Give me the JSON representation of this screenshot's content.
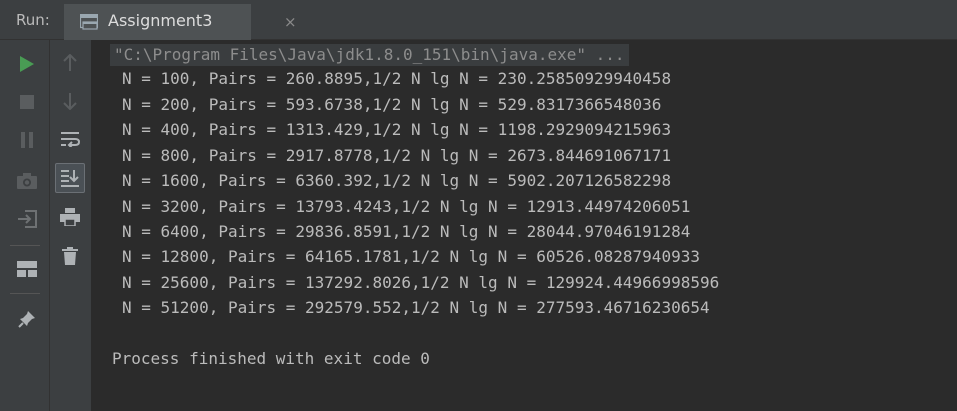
{
  "header": {
    "run_label": "Run:",
    "tab_title": "Assignment3",
    "tab_close": "×"
  },
  "toolbar_left": [
    "run-icon",
    "stop-icon",
    "pause-icon",
    "camera-icon",
    "login-icon",
    "layout-icon",
    "pin-icon"
  ],
  "toolbar_right": [
    "up-arrow-icon",
    "down-arrow-icon",
    "soft-wrap-icon",
    "scroll-to-end-icon",
    "print-icon",
    "trash-icon"
  ],
  "colors": {
    "run_green": "#499c54",
    "header_bg": "#3c3f41",
    "console_bg": "#2b2b2b",
    "text": "#bbbbbb"
  },
  "console": {
    "command": "\"C:\\Program Files\\Java\\jdk1.8.0_151\\bin\\java.exe\" ...",
    "lines": [
      "N = 100, Pairs = 260.8895,1/2 N lg N = 230.25850929940458",
      "N = 200, Pairs = 593.6738,1/2 N lg N = 529.8317366548036",
      "N = 400, Pairs = 1313.429,1/2 N lg N = 1198.2929094215963",
      "N = 800, Pairs = 2917.8778,1/2 N lg N = 2673.844691067171",
      "N = 1600, Pairs = 6360.392,1/2 N lg N = 5902.207126582298",
      "N = 3200, Pairs = 13793.4243,1/2 N lg N = 12913.44974206051",
      "N = 6400, Pairs = 29836.8591,1/2 N lg N = 28044.97046191284",
      "N = 12800, Pairs = 64165.1781,1/2 N lg N = 60526.08287940933",
      "N = 25600, Pairs = 137292.8026,1/2 N lg N = 129924.44966998596",
      "N = 51200, Pairs = 292579.552,1/2 N lg N = 277593.46716230654"
    ],
    "exit": "Process finished with exit code 0"
  }
}
